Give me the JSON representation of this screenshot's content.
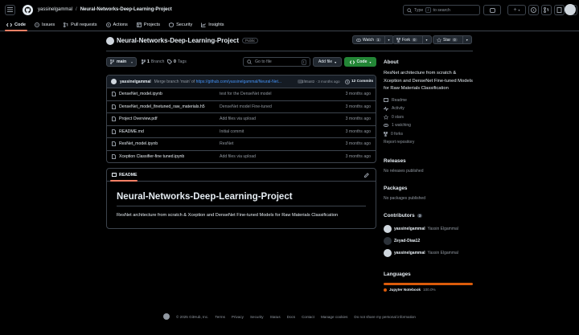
{
  "header": {
    "owner": "yassinelgammal",
    "separator": "/",
    "repo": "Neural-Networks-Deep-Learning-Project",
    "search_placeholder": "Type",
    "search_key": "/",
    "search_suffix": "to search",
    "plus": "+"
  },
  "tabs": [
    {
      "label": "Code"
    },
    {
      "label": "Issues"
    },
    {
      "label": "Pull requests"
    },
    {
      "label": "Actions"
    },
    {
      "label": "Projects"
    },
    {
      "label": "Security"
    },
    {
      "label": "Insights"
    }
  ],
  "repo": {
    "title": "Neural-Networks-Deep-Learning-Project",
    "visibility": "Public",
    "watch_label": "Watch",
    "watch_count": "1",
    "fork_label": "Fork",
    "fork_count": "0",
    "star_label": "Star",
    "star_count": "0"
  },
  "toolbar": {
    "branch": "main",
    "branches_count": "1",
    "branches_label": "Branch",
    "tags_count": "0",
    "tags_label": "Tags",
    "goto_placeholder": "Go to file",
    "goto_key": "t",
    "add_file": "Add file",
    "code": "Code"
  },
  "commit": {
    "author": "yassinelgammal",
    "message_prefix": "Merge branch 'main' of",
    "message_link": "https://github.com/yassinelgammal/Neural-Net...",
    "dots": "...",
    "hash_time": "1f85a82 · 3 months ago",
    "commits_count": "12 Commits"
  },
  "files": [
    {
      "name": "DenseNet_model.ipynb",
      "message": "test for the DenseNet model",
      "date": "3 months ago"
    },
    {
      "name": "DenseNet_model_finetuned_raw_materials.h5",
      "message": "DenseNet model Fine-tuned",
      "date": "3 months ago"
    },
    {
      "name": "Project Overview.pdf",
      "message": "Add files via upload",
      "date": "3 months ago"
    },
    {
      "name": "README.md",
      "message": "Initial commit",
      "date": "3 months ago"
    },
    {
      "name": "ResNet_model.ipynb",
      "message": "ResNet",
      "date": "3 months ago"
    },
    {
      "name": "Xception Classifier-fine tuned.ipynb",
      "message": "Add files via upload",
      "date": "3 months ago"
    }
  ],
  "readme": {
    "tab": "README",
    "title": "Neural-Networks-Deep-Learning-Project",
    "body": "ResNet architecture from scratch & Xception and DenseNet Fine-tuned Models for Raw Materials Classification"
  },
  "about": {
    "heading": "About",
    "description": "ResNet architecture from scratch & Xception and DenseNet Fine-tuned Models for Raw Materials Classification",
    "items": [
      {
        "icon": "book-icon",
        "label": "Readme"
      },
      {
        "icon": "pulse-icon",
        "label": "Activity"
      },
      {
        "icon": "star-icon",
        "label": "0 stars"
      },
      {
        "icon": "eye-icon",
        "label": "1 watching"
      },
      {
        "icon": "fork-icon",
        "label": "0 forks"
      }
    ],
    "report": "Report repository"
  },
  "releases": {
    "heading": "Releases",
    "empty": "No releases published"
  },
  "packages": {
    "heading": "Packages",
    "empty": "No packages published"
  },
  "contributors": {
    "heading": "Contributors",
    "count": "3",
    "list": [
      {
        "login": "yassinelgammal",
        "name": "Yassin Elgammal"
      },
      {
        "login": "Zeyad-Diaa12",
        "name": ""
      },
      {
        "login": "yassinelgammal",
        "name": "Yassin Elgammal"
      }
    ]
  },
  "languages": {
    "heading": "Languages",
    "name": "Jupyter Notebook",
    "percent": "100.0%",
    "fraction": 1.0,
    "color": "#da5b0b"
  },
  "footer": {
    "copyright": "© 2025 GitHub, Inc.",
    "links": [
      "Terms",
      "Privacy",
      "Security",
      "Status",
      "Docs",
      "Contact",
      "Manage cookies",
      "Do not share my personal information"
    ]
  },
  "colors": {
    "accent": "#f78166",
    "link": "#4493f8",
    "green": "#238636",
    "border": "#3d444d"
  }
}
